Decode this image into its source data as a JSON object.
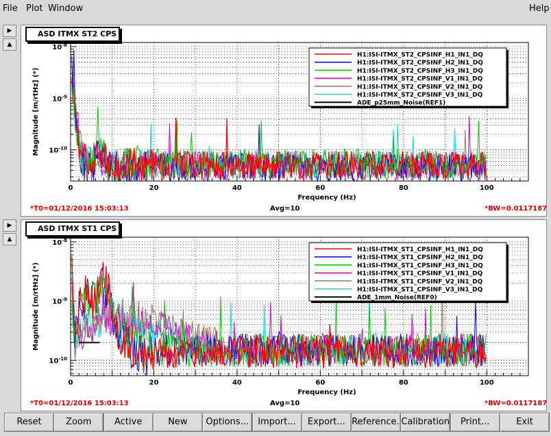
{
  "menu": {
    "file": "File",
    "plot": "Plot",
    "window": "Window",
    "help": "Help"
  },
  "buttons": [
    "Reset",
    "Zoom",
    "Active",
    "New",
    "Options...",
    "Import...",
    "Export...",
    "Reference...",
    "Calibration...",
    "Print...",
    "Exit"
  ],
  "colors": {
    "H1": "#ff0000",
    "H2": "#0000dd",
    "H3": "#00cc00",
    "V1": "#cc00cc",
    "V2": "#a07060",
    "V3": "#00dddd",
    "REF": "#000000"
  },
  "chart_data": [
    {
      "type": "line",
      "title": "ASD ITMX ST2 CPS",
      "xlabel": "Frequency (Hz)",
      "ylabel": "Magnitude [m/rtHz] (*)",
      "xlim": [
        0,
        110
      ],
      "ylim": [
        2.5e-11,
        1.2e-08
      ],
      "yscale": "log",
      "xticks": [
        0,
        20,
        40,
        60,
        80,
        100
      ],
      "yticks": [
        {
          "v": 1e-10,
          "label": "10-10"
        },
        {
          "v": 1e-09,
          "label": "10-9"
        },
        {
          "v": 1e-08,
          "label": "10-8"
        }
      ],
      "grid": true,
      "legend": "top-right",
      "footer": {
        "t0": "*T0=01/12/2016 15:03:13",
        "avg": "Avg=10",
        "bw": "*BW=0.0117187"
      },
      "series": [
        {
          "name": "H1:ISI-ITMX_ST2_CPSINF_H1_IN1_DQ",
          "x": [
            0,
            1,
            2,
            3,
            5,
            7,
            9,
            12,
            20,
            40,
            60,
            80,
            100
          ],
          "y": [
            8e-09,
            6e-10,
            1e-10,
            6e-11,
            5.5e-11,
            9e-11,
            6e-11,
            5e-11,
            5e-11,
            5e-11,
            5e-11,
            5e-11,
            5e-11
          ]
        },
        {
          "name": "H1:ISI-ITMX_ST2_CPSINF_H2_IN1_DQ",
          "x": [
            0,
            1,
            2,
            3,
            5,
            7,
            9,
            12,
            20,
            40,
            60,
            80,
            100
          ],
          "y": [
            9e-09,
            5e-10,
            9e-11,
            5e-11,
            5e-11,
            8e-11,
            5e-11,
            4.5e-11,
            4.5e-11,
            4.5e-11,
            4.5e-11,
            4.5e-11,
            4.5e-11
          ]
        },
        {
          "name": "H1:ISI-ITMX_ST2_CPSINF_H3_IN1_DQ",
          "x": [
            0,
            1,
            2,
            3,
            5,
            7,
            9,
            12,
            20,
            40,
            60,
            80,
            100
          ],
          "y": [
            7e-09,
            5e-10,
            1e-10,
            6e-11,
            6e-11,
            1e-10,
            6e-11,
            5.5e-11,
            5.5e-11,
            5.5e-11,
            5.5e-11,
            5.5e-11,
            5.5e-11
          ]
        },
        {
          "name": "H1:ISI-ITMX_ST2_CPSINF_V1_IN1_DQ",
          "x": [
            0,
            1,
            2,
            3,
            5,
            7,
            9,
            12,
            20,
            40,
            60,
            80,
            100
          ],
          "y": [
            6e-09,
            1e-09,
            2e-10,
            6e-11,
            5e-11,
            8e-11,
            5e-11,
            5e-11,
            5e-11,
            5e-11,
            5e-11,
            5e-11,
            5e-11
          ]
        },
        {
          "name": "H1:ISI-ITMX_ST2_CPSINF_V2_IN1_DQ",
          "x": [
            0,
            1,
            2,
            3,
            5,
            7,
            9,
            12,
            20,
            40,
            60,
            80,
            100
          ],
          "y": [
            5e-09,
            7e-10,
            1.5e-10,
            6e-11,
            6e-11,
            1e-10,
            6e-11,
            5e-11,
            5e-11,
            5e-11,
            5e-11,
            5e-11,
            5e-11
          ]
        },
        {
          "name": "H1:ISI-ITMX_ST2_CPSINF_V3_IN1_DQ",
          "x": [
            0,
            1,
            2,
            3,
            5,
            7,
            9,
            12,
            20,
            40,
            60,
            80,
            100
          ],
          "y": [
            5e-09,
            6e-10,
            1.2e-10,
            6e-11,
            5e-11,
            8e-11,
            5e-11,
            5e-11,
            5e-11,
            5e-11,
            5e-11,
            5e-11,
            5e-11
          ]
        },
        {
          "name": "ADE_p25mm_Noise(REF1)",
          "x": [],
          "y": []
        }
      ]
    },
    {
      "type": "line",
      "title": "ASD ITMX ST1 CPS",
      "xlabel": "Frequency (Hz)",
      "ylabel": "Magnitude [m/rtHz] (*)",
      "xlim": [
        0,
        110
      ],
      "ylim": [
        5.5e-11,
        1.2e-08
      ],
      "yscale": "log",
      "xticks": [
        0,
        20,
        40,
        60,
        80,
        100
      ],
      "yticks": [
        {
          "v": 1e-10,
          "label": "10-10"
        },
        {
          "v": 1e-09,
          "label": "10-9"
        },
        {
          "v": 1e-08,
          "label": "10-8"
        }
      ],
      "grid": true,
      "legend": "top-right",
      "footer": {
        "t0": "*T0=01/12/2016 15:03:13",
        "avg": "Avg=10",
        "bw": "*BW=0.0117187"
      },
      "series": [
        {
          "name": "H1:ISI-ITMX_ST1_CPSINF_H1_IN1_DQ",
          "x": [
            0,
            1,
            2,
            4,
            6,
            8,
            10,
            12,
            15,
            18,
            20,
            25,
            30,
            40,
            60,
            80,
            100
          ],
          "y": [
            8e-09,
            2e-10,
            1e-09,
            1.5e-09,
            1e-09,
            3e-09,
            8e-10,
            2.5e-10,
            1.5e-10,
            1.2e-10,
            1.4e-10,
            1.4e-10,
            1.4e-10,
            1.4e-10,
            1.4e-10,
            1.4e-10,
            1.4e-10
          ]
        },
        {
          "name": "H1:ISI-ITMX_ST1_CPSINF_H2_IN1_DQ",
          "x": [
            0,
            1,
            2,
            4,
            6,
            8,
            10,
            12,
            15,
            18,
            20,
            25,
            30,
            40,
            60,
            80,
            100
          ],
          "y": [
            7e-09,
            2e-10,
            8e-10,
            1.2e-09,
            1e-09,
            2e-09,
            6e-10,
            2.5e-10,
            1.5e-10,
            1.2e-10,
            1.5e-10,
            1.5e-10,
            1.5e-10,
            1.5e-10,
            1.5e-10,
            1.5e-10,
            1.5e-10
          ]
        },
        {
          "name": "H1:ISI-ITMX_ST1_CPSINF_H3_IN1_DQ",
          "x": [
            0,
            1,
            2,
            4,
            6,
            8,
            10,
            12,
            15,
            18,
            20,
            25,
            30,
            40,
            60,
            80,
            100
          ],
          "y": [
            6e-09,
            2e-10,
            8e-10,
            1.2e-09,
            1e-09,
            1.5e-09,
            7e-10,
            3e-10,
            2e-10,
            1.3e-10,
            1.5e-10,
            1.5e-10,
            1.5e-10,
            1.5e-10,
            1.5e-10,
            1.5e-10,
            1.5e-10
          ]
        },
        {
          "name": "H1:ISI-ITMX_ST1_CPSINF_V1_IN1_DQ",
          "x": [
            0,
            1,
            2,
            4,
            6,
            8,
            10,
            12,
            15,
            18,
            20,
            25,
            30,
            40,
            60,
            80,
            100
          ],
          "y": [
            5e-09,
            1.5e-10,
            3e-10,
            4e-10,
            4e-10,
            6e-10,
            5e-10,
            4e-10,
            4e-10,
            4e-10,
            4e-10,
            3e-10,
            2e-10,
            1.5e-10,
            1.5e-10,
            1.5e-10,
            1.5e-10
          ]
        },
        {
          "name": "H1:ISI-ITMX_ST1_CPSINF_V2_IN1_DQ",
          "x": [
            0,
            1,
            2,
            4,
            6,
            8,
            10,
            12,
            15,
            18,
            20,
            25,
            30,
            40,
            60,
            80,
            100
          ],
          "y": [
            5e-09,
            1.5e-10,
            3e-10,
            4e-10,
            4e-10,
            6e-10,
            5e-10,
            5e-10,
            5e-10,
            4e-10,
            4e-10,
            3e-10,
            2.5e-10,
            1.5e-10,
            1.5e-10,
            1.5e-10,
            1.5e-10
          ]
        },
        {
          "name": "H1:ISI-ITMX_ST1_CPSINF_V3_IN1_DQ",
          "x": [
            0,
            1,
            2,
            4,
            6,
            8,
            10,
            12,
            15,
            18,
            20,
            25,
            30,
            40,
            60,
            80,
            100
          ],
          "y": [
            5e-09,
            1.5e-10,
            3e-10,
            4e-10,
            4e-10,
            6e-10,
            5e-10,
            4e-10,
            4e-10,
            3e-10,
            3e-10,
            2.5e-10,
            2e-10,
            1.5e-10,
            1.5e-10,
            1.5e-10,
            1.5e-10
          ]
        },
        {
          "name": "ADE_1mm_Noise(REF0)",
          "x": [
            2,
            5,
            7
          ],
          "y": [
            2e-10,
            2e-10,
            2e-10
          ]
        }
      ]
    }
  ]
}
